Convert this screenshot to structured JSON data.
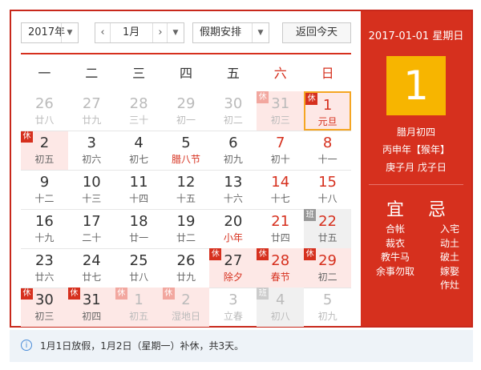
{
  "toolbar": {
    "year": "2017年",
    "month": "1月",
    "holiday": "假期安排",
    "today_btn": "返回今天"
  },
  "weekdays": [
    "一",
    "二",
    "三",
    "四",
    "五",
    "六",
    "日"
  ],
  "days": [
    {
      "n": "26",
      "l": "廿八",
      "other": true
    },
    {
      "n": "27",
      "l": "廿九",
      "other": true
    },
    {
      "n": "28",
      "l": "三十",
      "other": true
    },
    {
      "n": "29",
      "l": "初一",
      "other": true
    },
    {
      "n": "30",
      "l": "初二",
      "other": true
    },
    {
      "n": "31",
      "l": "初三",
      "other": true,
      "tag": "休",
      "hol": true
    },
    {
      "n": "1",
      "l": "元旦",
      "tag": "休",
      "hol": true,
      "red": true,
      "lred": true,
      "today": true
    },
    {
      "n": "2",
      "l": "初五",
      "tag": "休",
      "hol": true
    },
    {
      "n": "3",
      "l": "初六"
    },
    {
      "n": "4",
      "l": "初七"
    },
    {
      "n": "5",
      "l": "腊八节",
      "lred": true
    },
    {
      "n": "6",
      "l": "初九"
    },
    {
      "n": "7",
      "l": "初十",
      "red": true
    },
    {
      "n": "8",
      "l": "十一",
      "red": true
    },
    {
      "n": "9",
      "l": "十二"
    },
    {
      "n": "10",
      "l": "十三"
    },
    {
      "n": "11",
      "l": "十四"
    },
    {
      "n": "12",
      "l": "十五"
    },
    {
      "n": "13",
      "l": "十六"
    },
    {
      "n": "14",
      "l": "十七",
      "red": true
    },
    {
      "n": "15",
      "l": "十八",
      "red": true
    },
    {
      "n": "16",
      "l": "十九"
    },
    {
      "n": "17",
      "l": "二十"
    },
    {
      "n": "18",
      "l": "廿一"
    },
    {
      "n": "19",
      "l": "廿二"
    },
    {
      "n": "20",
      "l": "小年",
      "lred": true
    },
    {
      "n": "21",
      "l": "廿四",
      "red": true
    },
    {
      "n": "22",
      "l": "廿五",
      "red": true,
      "tag": "班",
      "work": true
    },
    {
      "n": "23",
      "l": "廿六"
    },
    {
      "n": "24",
      "l": "廿七"
    },
    {
      "n": "25",
      "l": "廿八"
    },
    {
      "n": "26",
      "l": "廿九"
    },
    {
      "n": "27",
      "l": "除夕",
      "tag": "休",
      "hol": true,
      "lred": true
    },
    {
      "n": "28",
      "l": "春节",
      "tag": "休",
      "hol": true,
      "red": true,
      "lred": true
    },
    {
      "n": "29",
      "l": "初二",
      "tag": "休",
      "hol": true,
      "red": true
    },
    {
      "n": "30",
      "l": "初三",
      "tag": "休",
      "hol": true
    },
    {
      "n": "31",
      "l": "初四",
      "tag": "休",
      "hol": true
    },
    {
      "n": "1",
      "l": "初五",
      "tag": "休",
      "hol": true,
      "other": true
    },
    {
      "n": "2",
      "l": "湿地日",
      "tag": "休",
      "hol": true,
      "other": true
    },
    {
      "n": "3",
      "l": "立春",
      "other": true
    },
    {
      "n": "4",
      "l": "初八",
      "tag": "班",
      "work": true,
      "other": true
    },
    {
      "n": "5",
      "l": "初九",
      "other": true
    }
  ],
  "panel": {
    "date_line": "2017-01-01 星期日",
    "big_day": "1",
    "lunar": "腊月初四",
    "year_gz": "丙申年【猴年】",
    "month_day_gz": "庚子月 戊子日",
    "yi": "宜",
    "ji": "忌",
    "yi_items": [
      "合帐",
      "裁衣",
      "教牛马",
      "余事勿取"
    ],
    "ji_items": [
      "入宅",
      "动土",
      "破土",
      "嫁娶",
      "作灶"
    ]
  },
  "footer": {
    "info_icon": "i",
    "note": "1月1日放假，1月2日（星期一）补休，共3天。"
  },
  "colors": {
    "accent": "#d6301e",
    "today_box": "#f7b500",
    "holiday_bg": "#fde8e6",
    "work_bg": "#f0f0f0"
  }
}
